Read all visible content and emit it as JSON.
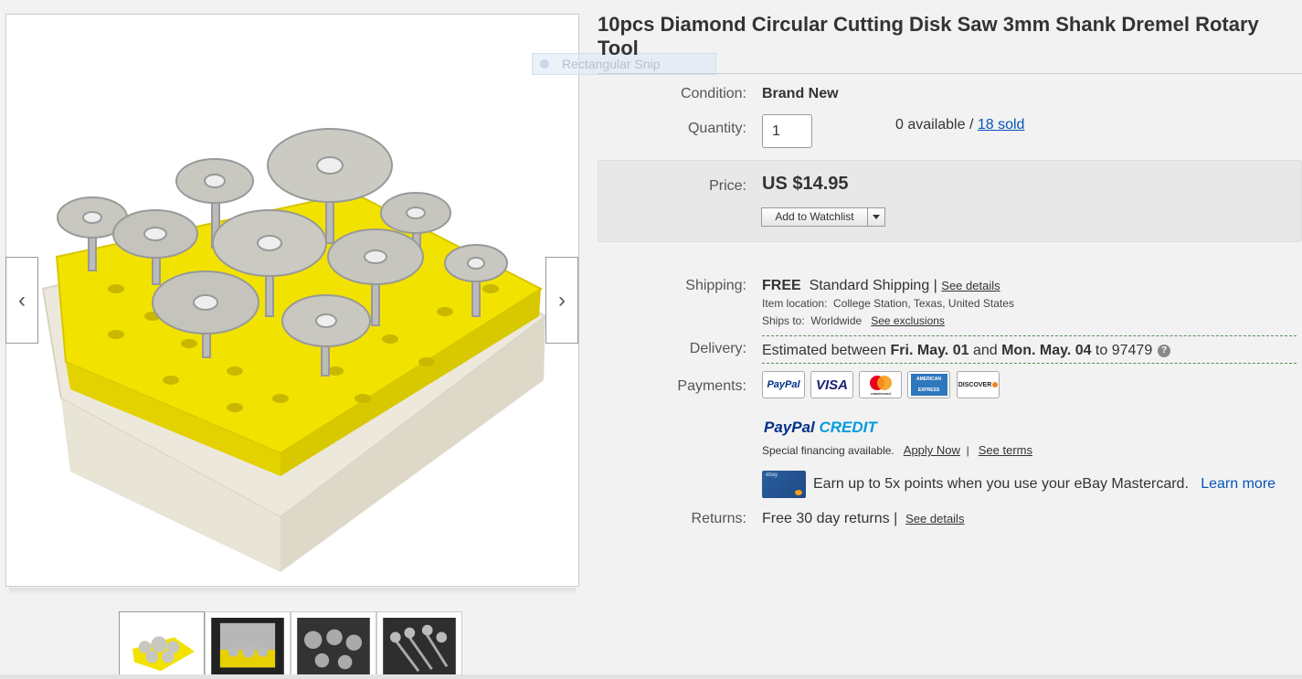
{
  "listing": {
    "title": "10pcs Diamond Circular Cutting Disk Saw 3mm Shank Dremel Rotary Tool"
  },
  "snip_overlay": {
    "label": "Rectangular Snip"
  },
  "gallery": {
    "prev_icon": "chevron-left-icon",
    "next_icon": "chevron-right-icon",
    "prev_glyph": "‹",
    "next_glyph": "›"
  },
  "condition": {
    "label": "Condition:",
    "value": "Brand New"
  },
  "quantity": {
    "label": "Quantity:",
    "value": "1",
    "available": "0 available / ",
    "sold": "18 sold"
  },
  "price": {
    "label": "Price:",
    "value": "US $14.95",
    "watch_button": "Add to Watchlist"
  },
  "shipping": {
    "label": "Shipping:",
    "free": "FREE",
    "method": "Standard Shipping |",
    "see_details": "See details",
    "location_label": "Item location:",
    "location_value": "College Station, Texas, United States",
    "ships_to_label": "Ships to:",
    "ships_to_value": "Worldwide",
    "see_exclusions": "See exclusions"
  },
  "delivery": {
    "label": "Delivery:",
    "prefix": "Estimated between ",
    "date1": "Fri. May. 01",
    "middle": " and ",
    "date2": "Mon. May. 04",
    "suffix": " to 97479"
  },
  "payments": {
    "label": "Payments:",
    "cards": [
      "PayPal",
      "VISA",
      "mastercard",
      "AMERICAN EXPRESS",
      "DISCOVER"
    ],
    "paypal_credit_1": "PayPal",
    "paypal_credit_2": " CREDIT",
    "financing": "Special financing available.",
    "apply_now": "Apply Now",
    "separator": "|",
    "see_terms": "See terms",
    "earn": "Earn up to 5x points when you use your eBay Mastercard.",
    "learn_more": "Learn more",
    "mc_card_text": "ebay"
  },
  "returns": {
    "label": "Returns:",
    "value": "Free 30 day returns |",
    "see_details": "See details"
  },
  "colors": {
    "link_blue": "#0654ba",
    "paypal_blue": "#003087",
    "paypal_light": "#009cde",
    "product_yellow": "#f2e200"
  }
}
